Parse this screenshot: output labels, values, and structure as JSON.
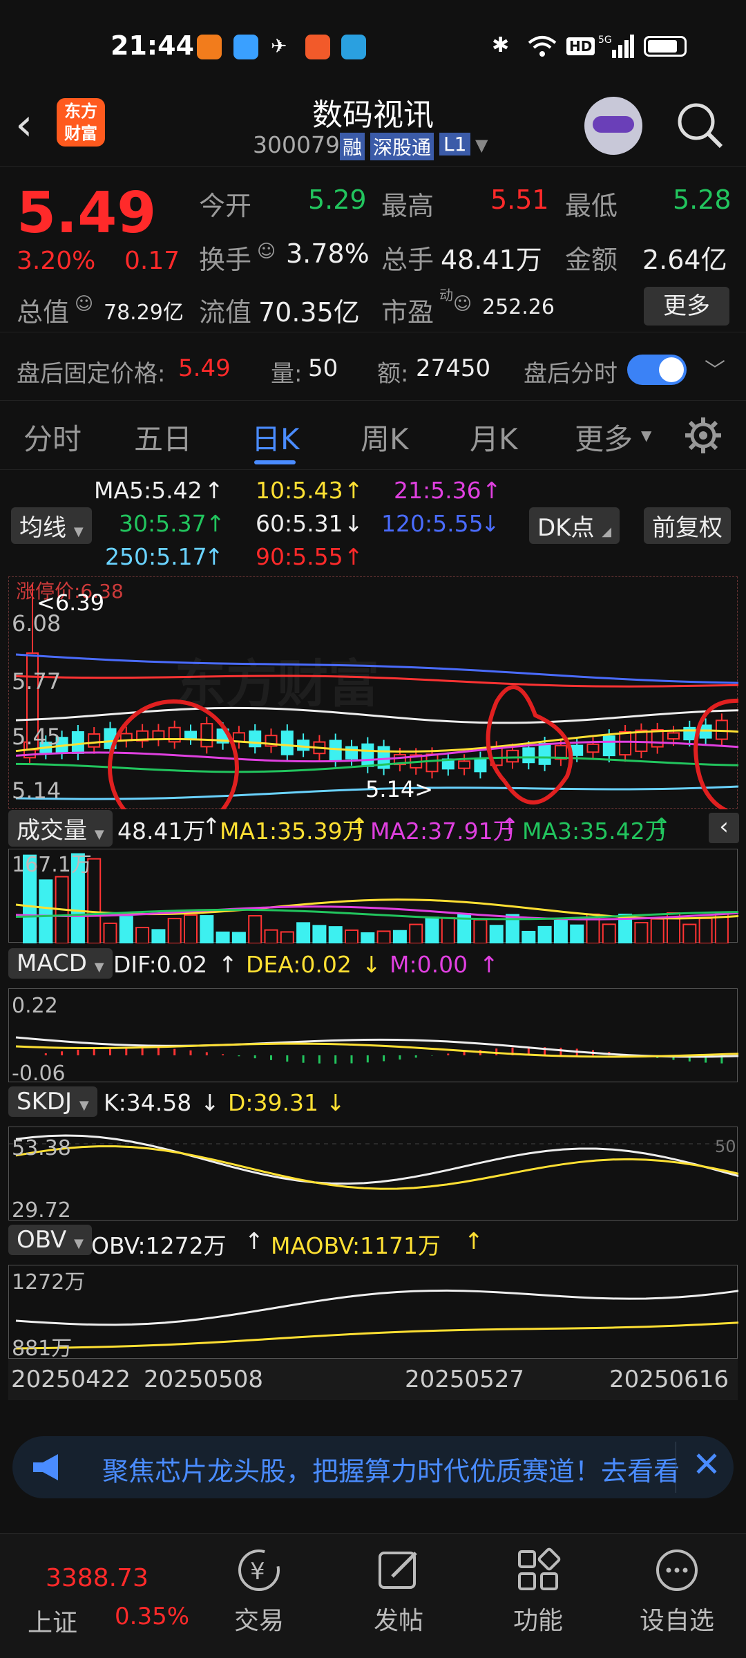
{
  "status_bar": {
    "time": "21:44"
  },
  "header": {
    "logo_text": "东方财富",
    "title": "数码视讯",
    "code": "300079",
    "badge_rong": "融",
    "badge_sgt": "深股通",
    "badge_l1": "L1"
  },
  "quote": {
    "price": "5.49",
    "change_pct": "3.20%",
    "change": "0.17",
    "open_label": "今开",
    "open": "5.29",
    "high_label": "最高",
    "high": "5.51",
    "low_label": "最低",
    "low": "5.28",
    "turnover_label": "换手",
    "turnover": "3.78%",
    "volume_label": "总手",
    "volume": "48.41万",
    "amount_label": "金额",
    "amount": "2.64亿",
    "total_mv_label": "总值",
    "total_mv": "78.29亿",
    "float_mv_label": "流值",
    "float_mv": "70.35亿",
    "pe_label": "市盈",
    "pe_sup": "动",
    "pe": "252.26",
    "more_button": "更多"
  },
  "after_hours": {
    "price_label": "盘后固定价格:",
    "price": "5.49",
    "vol_label": "量:",
    "vol": "50",
    "amt_label": "额:",
    "amt": "27450",
    "toggle_label": "盘后分时"
  },
  "tabs": [
    "分时",
    "五日",
    "日K",
    "周K",
    "月K",
    "更多"
  ],
  "ma_legend": {
    "chip": "均线",
    "ma5": "MA5:5.42",
    "ma10": "10:5.43",
    "ma21": "21:5.36",
    "ma30": "30:5.37",
    "ma60": "60:5.31",
    "ma120": "120:5.55",
    "ma250": "250:5.17",
    "ma90": "90:5.55",
    "dk_chip": "DK点",
    "adjust_chip": "前复权"
  },
  "kline": {
    "limit_up_label": "涨停价:6.38",
    "max_label": "<6.39",
    "min_label": "5.14>",
    "y_labels": [
      "6.08",
      "5.77",
      "5.45",
      "5.14"
    ],
    "watermark": "东方财富"
  },
  "volume_panel": {
    "chip": "成交量",
    "vol": "48.41万",
    "ma1": "MA1:35.39万",
    "ma2": "MA2:37.91万",
    "ma3": "MA3:35.42万",
    "ymax": "167.1万"
  },
  "macd_panel": {
    "chip": "MACD",
    "dif": "DIF:0.02",
    "dea": "DEA:0.02",
    "m": "M:0.00",
    "ymax": "0.22",
    "ymin": "-0.06"
  },
  "skdj_panel": {
    "chip": "SKDJ",
    "k": "K:34.58",
    "d": "D:39.31",
    "ymax": "53.38",
    "ymin": "29.72",
    "mid": "50"
  },
  "obv_panel": {
    "chip": "OBV",
    "obv": "OBV:1272万",
    "maobv": "MAOBV:1171万",
    "ymax": "1272万",
    "ymin": "881万"
  },
  "dates": [
    "20250422",
    "20250508",
    "20250527",
    "20250616"
  ],
  "banner": {
    "text": "聚焦芯片龙头股，把握算力时代优质赛道！去看看"
  },
  "bottom_nav": {
    "index_value": "3388.73",
    "index_name": "上证",
    "index_change": "0.35%",
    "items": [
      "交易",
      "发帖",
      "功能",
      "设自选"
    ]
  },
  "colors": {
    "up": "#ff2a2a",
    "down": "#22c55e",
    "accent": "#4a8cff",
    "bg": "#111111"
  }
}
